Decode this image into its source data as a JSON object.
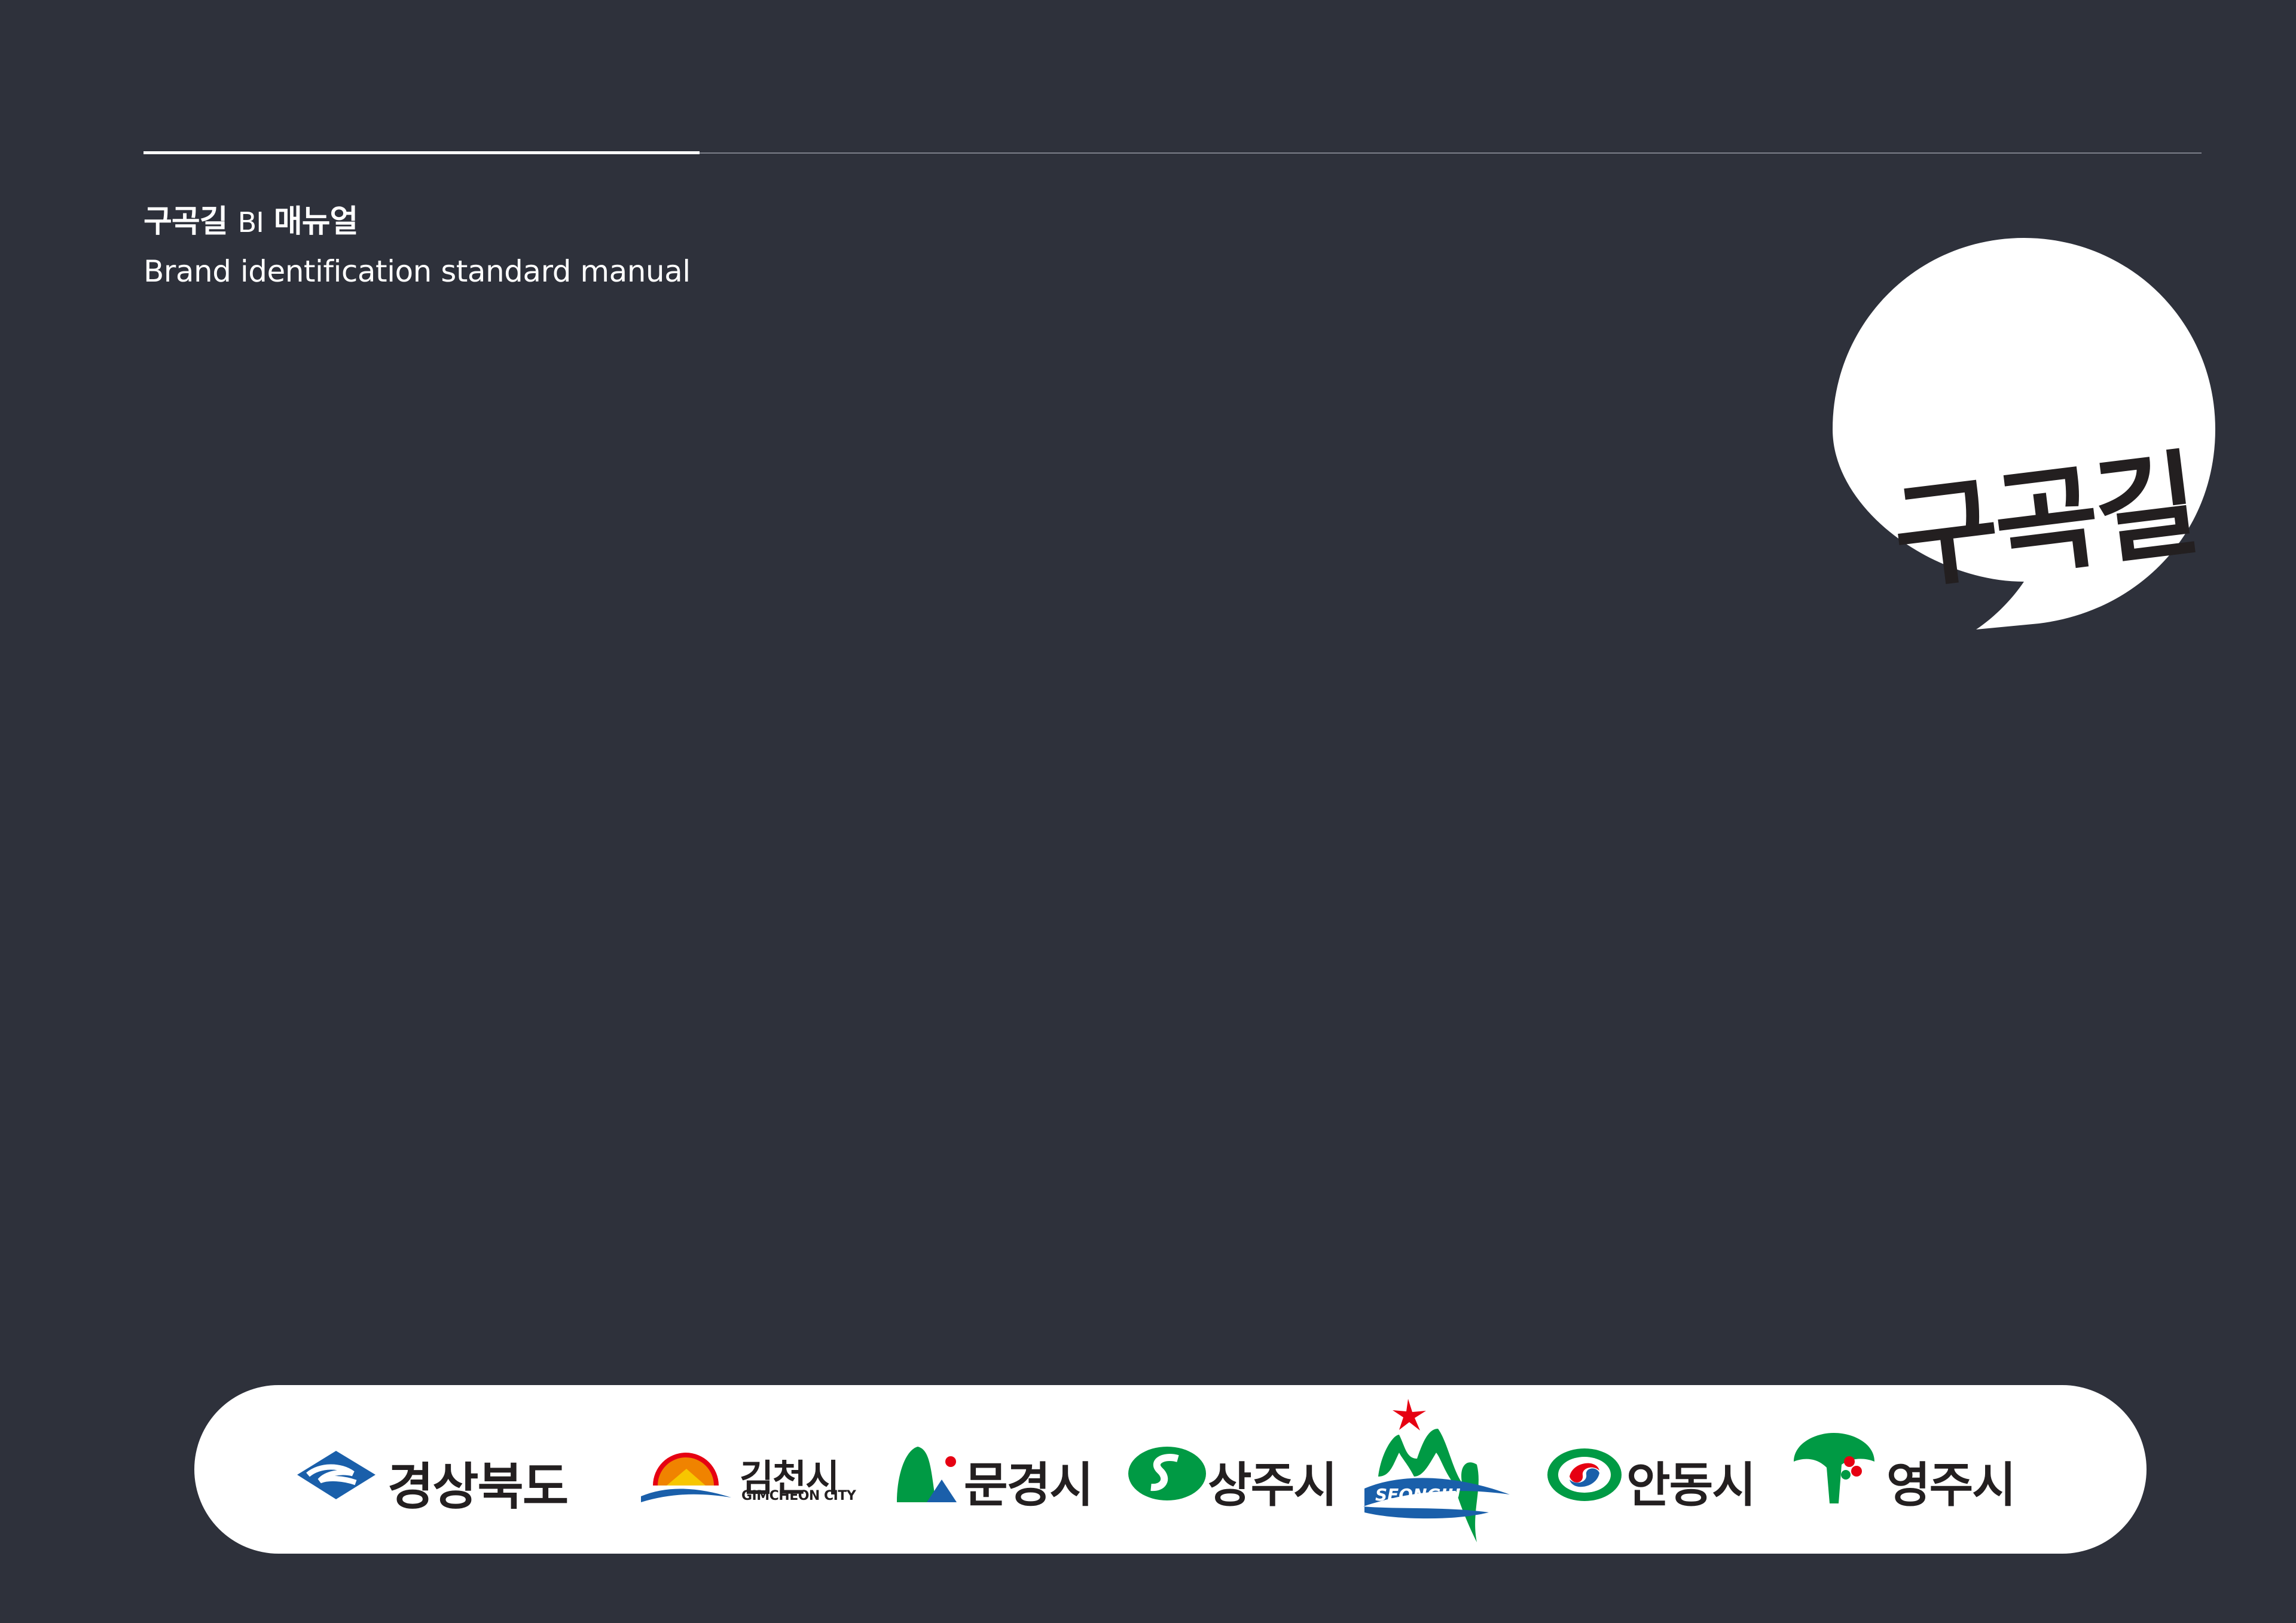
{
  "header": {
    "title_part1": "구곡길",
    "title_part2": "BI",
    "title_part3": "매뉴얼",
    "subtitle": "Brand identification standard manual"
  },
  "brand_mark": {
    "text": "구곡길",
    "icon": "speech-bubble-icon"
  },
  "partners": [
    {
      "name": "경상북도",
      "icon": "gyeongbuk-emblem-icon"
    },
    {
      "name": "김천시",
      "sub": "GIMCHEON CITY",
      "icon": "gimcheon-emblem-icon"
    },
    {
      "name": "문경시",
      "icon": "mungyeong-emblem-icon"
    },
    {
      "name": "상주시",
      "icon": "sangju-emblem-icon"
    },
    {
      "name": "SEONGJU",
      "icon": "seongju-emblem-icon"
    },
    {
      "name": "안동시",
      "icon": "andong-emblem-icon"
    },
    {
      "name": "영주시",
      "icon": "yeongju-emblem-icon"
    }
  ],
  "colors": {
    "background": "#2e313b",
    "white": "#ffffff",
    "ink": "#231f20",
    "blue": "#1a5faa",
    "green": "#009a44",
    "red": "#e60012"
  }
}
